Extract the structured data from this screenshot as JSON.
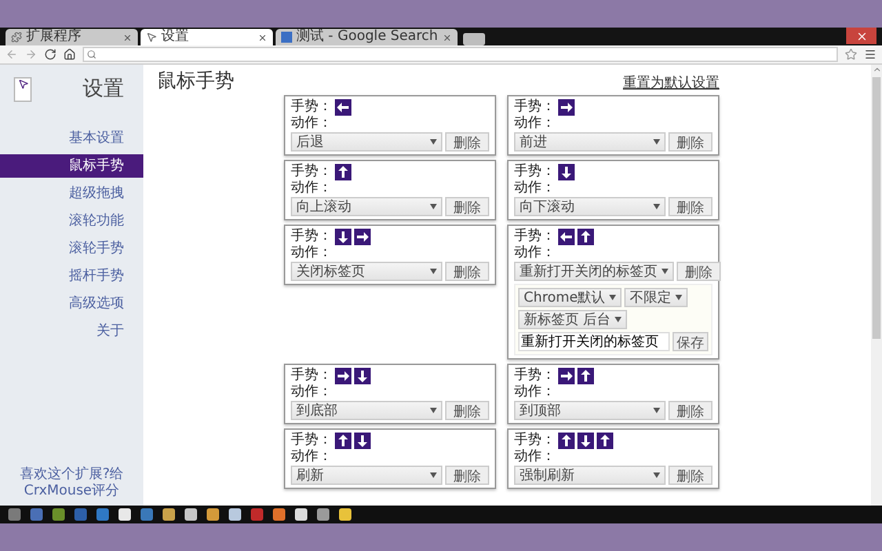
{
  "browser": {
    "tabs": [
      {
        "title": "扩展程序",
        "selected": false
      },
      {
        "title": "设置",
        "selected": true
      },
      {
        "title": "测试 - Google Search",
        "selected": false
      }
    ]
  },
  "sidebar": {
    "title": "设置",
    "items": [
      {
        "label": "基本设置",
        "selected": false
      },
      {
        "label": "鼠标手势",
        "selected": true
      },
      {
        "label": "超级拖拽",
        "selected": false
      },
      {
        "label": "滚轮功能",
        "selected": false
      },
      {
        "label": "滚轮手势",
        "selected": false
      },
      {
        "label": "摇杆手势",
        "selected": false
      },
      {
        "label": "高级选项",
        "selected": false
      },
      {
        "label": "关于",
        "selected": false
      }
    ],
    "footer_link": "喜欢这个扩展?给CrxMouse评分"
  },
  "page": {
    "title": "鼠标手势",
    "reset_link": "重置为默认设置",
    "gestures": [
      {
        "gesture_label": "手势：",
        "strokes": [
          {
            "kind": "left"
          }
        ],
        "action_label": "动作：",
        "action": "后退",
        "delete": "删除"
      },
      {
        "gesture_label": "手势：",
        "strokes": [
          {
            "kind": "right"
          }
        ],
        "action_label": "动作：",
        "action": "前进",
        "delete": "删除"
      },
      {
        "gesture_label": "手势：",
        "strokes": [
          {
            "kind": "up"
          }
        ],
        "action_label": "动作：",
        "action": "向上滚动",
        "delete": "删除"
      },
      {
        "gesture_label": "手势：",
        "strokes": [
          {
            "kind": "down"
          }
        ],
        "action_label": "动作：",
        "action": "向下滚动",
        "delete": "删除"
      },
      {
        "gesture_label": "手势：",
        "strokes": [
          {
            "kind": "down"
          },
          {
            "kind": "right"
          }
        ],
        "action_label": "动作：",
        "action": "关闭标签页",
        "delete": "删除"
      },
      {
        "gesture_label": "手势：",
        "strokes": [
          {
            "kind": "left"
          },
          {
            "kind": "up"
          }
        ],
        "action_label": "动作：",
        "action": "重新打开关闭的标签页",
        "delete": "删除",
        "options": {
          "selects": [
            "Chrome默认",
            "不限定",
            "新标签页 后台"
          ],
          "name_value": "重新打开关闭的标签页",
          "save": "保存"
        }
      },
      {
        "gesture_label": "手势：",
        "strokes": [
          {
            "kind": "right"
          },
          {
            "kind": "down"
          }
        ],
        "action_label": "动作：",
        "action": "到底部",
        "delete": "删除"
      },
      {
        "gesture_label": "手势：",
        "strokes": [
          {
            "kind": "right"
          },
          {
            "kind": "up"
          }
        ],
        "action_label": "动作：",
        "action": "到顶部",
        "delete": "删除"
      },
      {
        "gesture_label": "手势：",
        "strokes": [
          {
            "kind": "up"
          },
          {
            "kind": "down"
          }
        ],
        "action_label": "动作：",
        "action": "刷新",
        "delete": "删除"
      },
      {
        "gesture_label": "手势：",
        "strokes": [
          {
            "kind": "up"
          },
          {
            "kind": "down"
          },
          {
            "kind": "up"
          }
        ],
        "action_label": "动作：",
        "action": "强制刷新",
        "delete": "删除"
      }
    ]
  }
}
